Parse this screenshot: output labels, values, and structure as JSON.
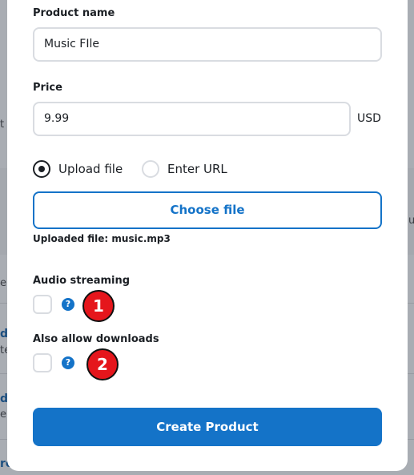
{
  "background": {
    "frag_t": "t",
    "frag_e": "e",
    "frag_d1": "d",
    "frag_te": "te",
    "frag_d2": "d",
    "frag_e2": "e",
    "frag_ro": "ro",
    "frag_u": "u"
  },
  "form": {
    "product_name_label": "Product name",
    "product_name_value": "Music FIle",
    "price_label": "Price",
    "price_value": "9.99",
    "currency": "USD",
    "radio_upload_label": "Upload file",
    "radio_url_label": "Enter URL",
    "radio_selected": "upload",
    "choose_file_label": "Choose file",
    "uploaded_file_text": "Uploaded file: music.mp3",
    "audio_streaming_label": "Audio streaming",
    "audio_streaming_checked": false,
    "allow_downloads_label": "Also allow downloads",
    "allow_downloads_checked": false,
    "help_glyph": "?",
    "create_button_label": "Create Product"
  },
  "annotations": {
    "badge_1": "1",
    "badge_2": "2"
  },
  "colors": {
    "accent": "#1473c8",
    "badge": "#e5161c"
  }
}
